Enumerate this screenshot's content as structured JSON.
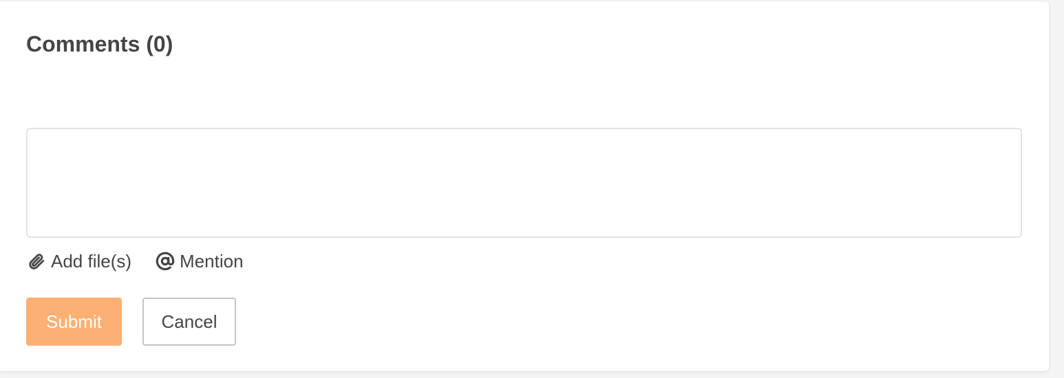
{
  "comments": {
    "title": "Comments (0)",
    "input": {
      "value": "",
      "placeholder": ""
    },
    "tools": {
      "add_files_label": "Add file(s)",
      "add_files_icon": "paperclip-icon",
      "mention_label": "Mention",
      "mention_icon": "at-sign-icon"
    },
    "actions": {
      "submit_label": "Submit",
      "cancel_label": "Cancel"
    }
  },
  "colors": {
    "submit_bg": "#fdb074",
    "text": "#454545",
    "border": "#e3e3e3"
  }
}
